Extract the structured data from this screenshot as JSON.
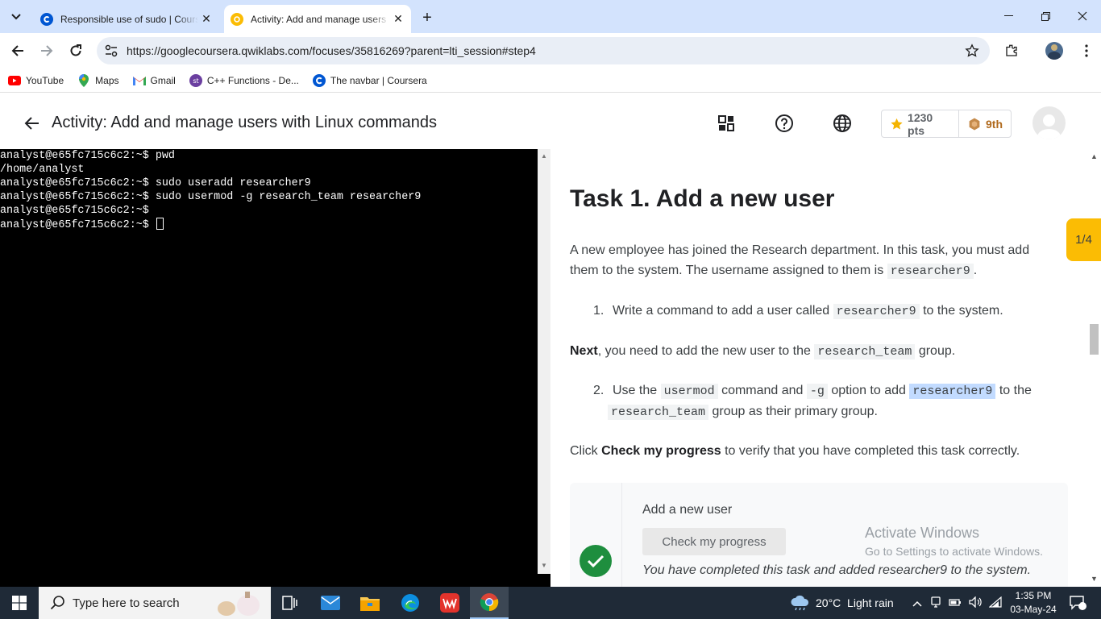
{
  "browser": {
    "tabs": [
      {
        "title": "Responsible use of sudo | Coursera",
        "active": false
      },
      {
        "title": "Activity: Add and manage users",
        "active": true
      }
    ],
    "url": "https://googlecoursera.qwiklabs.com/focuses/35816269?parent=lti_session#step4",
    "bookmarks": [
      {
        "label": "YouTube",
        "icon": "youtube-icon"
      },
      {
        "label": "Maps",
        "icon": "maps-icon"
      },
      {
        "label": "Gmail",
        "icon": "gmail-icon"
      },
      {
        "label": "C++ Functions - De...",
        "icon": "st-icon"
      },
      {
        "label": "The navbar | Coursera",
        "icon": "coursera-icon"
      }
    ]
  },
  "lab": {
    "title": "Activity: Add and manage users with Linux commands",
    "points": "1230 pts",
    "rank": "9th"
  },
  "terminal": {
    "lines": [
      "analyst@e65fc715c6c2:~$ pwd",
      "/home/analyst",
      "analyst@e65fc715c6c2:~$ sudo useradd researcher9",
      "analyst@e65fc715c6c2:~$ sudo usermod -g research_team researcher9",
      "analyst@e65fc715c6c2:~$",
      "analyst@e65fc715c6c2:~$ "
    ]
  },
  "instructions": {
    "heading": "Task 1. Add a new user",
    "intro_1": "A new employee has joined the Research department. In this task, you must add",
    "intro_2": "them to the system. The username assigned to them is",
    "intro_code": "researcher9",
    "step1_num": "1.",
    "step1_a": "Write a command to add a user called",
    "step1_code": "researcher9",
    "step1_b": "to the system.",
    "next_bold": "Next",
    "next_a": ", you need to add the new user to the",
    "next_code": "research_team",
    "next_b": "group.",
    "step2_num": "2.",
    "step2_a": "Use the",
    "step2_code1": "usermod",
    "step2_b": "command and",
    "step2_code2": "-g",
    "step2_c": "option to add",
    "step2_code3": "researcher9",
    "step2_d": "to the",
    "step2_code4": "research_team",
    "step2_e": "group as their primary group.",
    "click_a": "Click",
    "click_bold": "Check my progress",
    "click_b": "to verify that you have completed this task correctly.",
    "card_title": "Add a new user",
    "check_button": "Check my progress",
    "card_done": "You have completed this task and added researcher9 to the system.",
    "step_badge": "1/4"
  },
  "watermark": {
    "line1": "Activate Windows",
    "line2": "Go to Settings to activate Windows."
  },
  "taskbar": {
    "search_placeholder": "Type here to search",
    "weather": "20°C  Light rain",
    "time": "1:35 PM",
    "date": "03-May-24",
    "notifications": "2"
  },
  "colors": {
    "tabstrip": "#d3e3fd",
    "success": "#1e8e3e",
    "badge": "#fbbc04",
    "taskbar": "#1f2a37"
  }
}
